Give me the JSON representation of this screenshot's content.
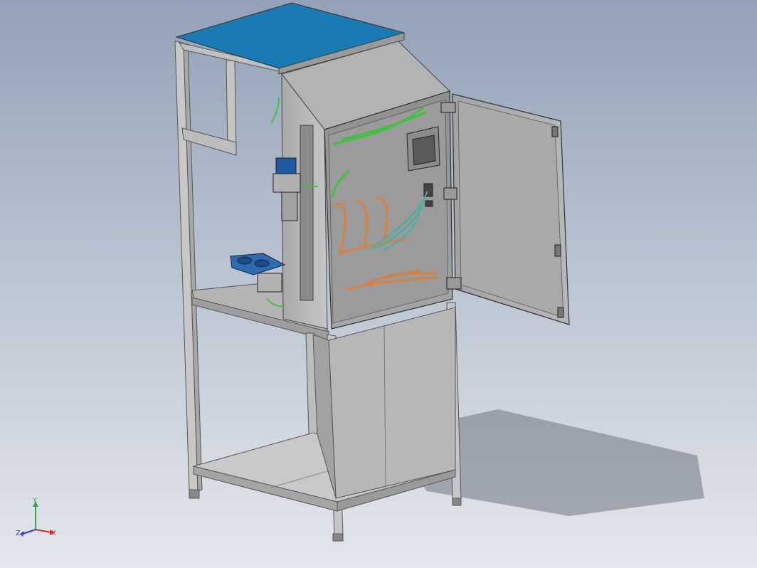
{
  "viewport": {
    "background_top": "#93a2b8",
    "background_bottom": "#e4e7ec"
  },
  "model": {
    "frame_color": "#c8c8c8",
    "panel_color": "#b9b9b9",
    "top_panel_color": "#1a7bb4",
    "cable_green": "#3fc23f",
    "cable_orange": "#d9803a",
    "cable_teal": "#3db3a8"
  },
  "triad": {
    "x_label": "X",
    "y_label": "Y",
    "z_label": "Z",
    "x_color": "#d22a2a",
    "y_color": "#2fa84f",
    "z_color": "#2a40c8"
  }
}
